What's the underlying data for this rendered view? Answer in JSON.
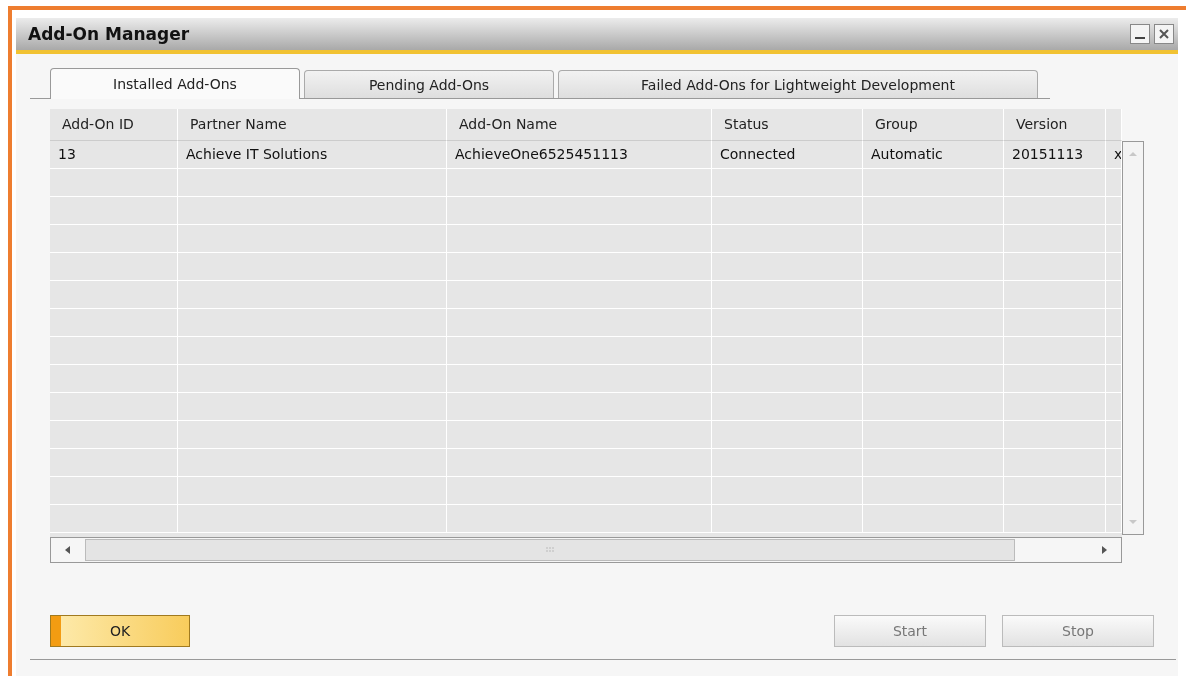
{
  "window": {
    "title": "Add-On Manager"
  },
  "tabs": [
    {
      "label": "Installed Add-Ons",
      "selected": true
    },
    {
      "label": "Pending Add-Ons",
      "selected": false
    },
    {
      "label": "Failed Add-Ons for Lightweight Development",
      "selected": false
    }
  ],
  "table": {
    "columns": [
      "Add-On ID",
      "Partner Name",
      "Add-On Name",
      "Status",
      "Group",
      "Version"
    ],
    "rows": [
      [
        "13",
        "Achieve IT Solutions",
        "AchieveOne6525451113",
        "Connected",
        "Automatic",
        "20151113",
        "x"
      ]
    ]
  },
  "buttons": [
    {
      "label": "OK",
      "kind": "primary"
    },
    {
      "label": "Start",
      "kind": "disabled"
    },
    {
      "label": "Stop",
      "kind": "disabled"
    }
  ]
}
